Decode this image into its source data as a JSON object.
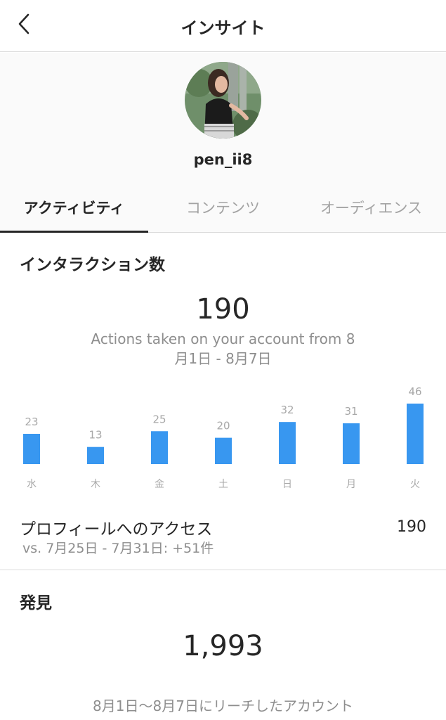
{
  "header": {
    "title": "インサイト",
    "back_icon": "chevron-left-icon"
  },
  "profile": {
    "username": "pen_ii8"
  },
  "tabs": [
    {
      "label": "アクティビティ",
      "active": true
    },
    {
      "label": "コンテンツ",
      "active": false
    },
    {
      "label": "オーディエンス",
      "active": false
    }
  ],
  "interactions": {
    "heading": "インタラクション数",
    "total": "190",
    "caption_line1": "Actions taken on your account from 8",
    "caption_line2": "月1日 - 8月7日"
  },
  "chart_data": {
    "type": "bar",
    "categories": [
      "水",
      "木",
      "金",
      "土",
      "日",
      "月",
      "火"
    ],
    "values": [
      23,
      13,
      25,
      20,
      32,
      31,
      46
    ],
    "ylim": [
      0,
      46
    ],
    "bar_color": "#3897f0",
    "grid": false
  },
  "profile_access": {
    "label": "プロフィールへのアクセス",
    "value": "190",
    "comparison": "vs. 7月25日 - 7月31日: +51件"
  },
  "discovery": {
    "heading": "発見",
    "total": "1,993",
    "caption": "8月1日〜8月7日にリーチしたアカウント"
  },
  "colors": {
    "accent": "#3897f0",
    "text": "#262626",
    "muted": "#8e8e8e",
    "divider": "#dbdbdb"
  }
}
